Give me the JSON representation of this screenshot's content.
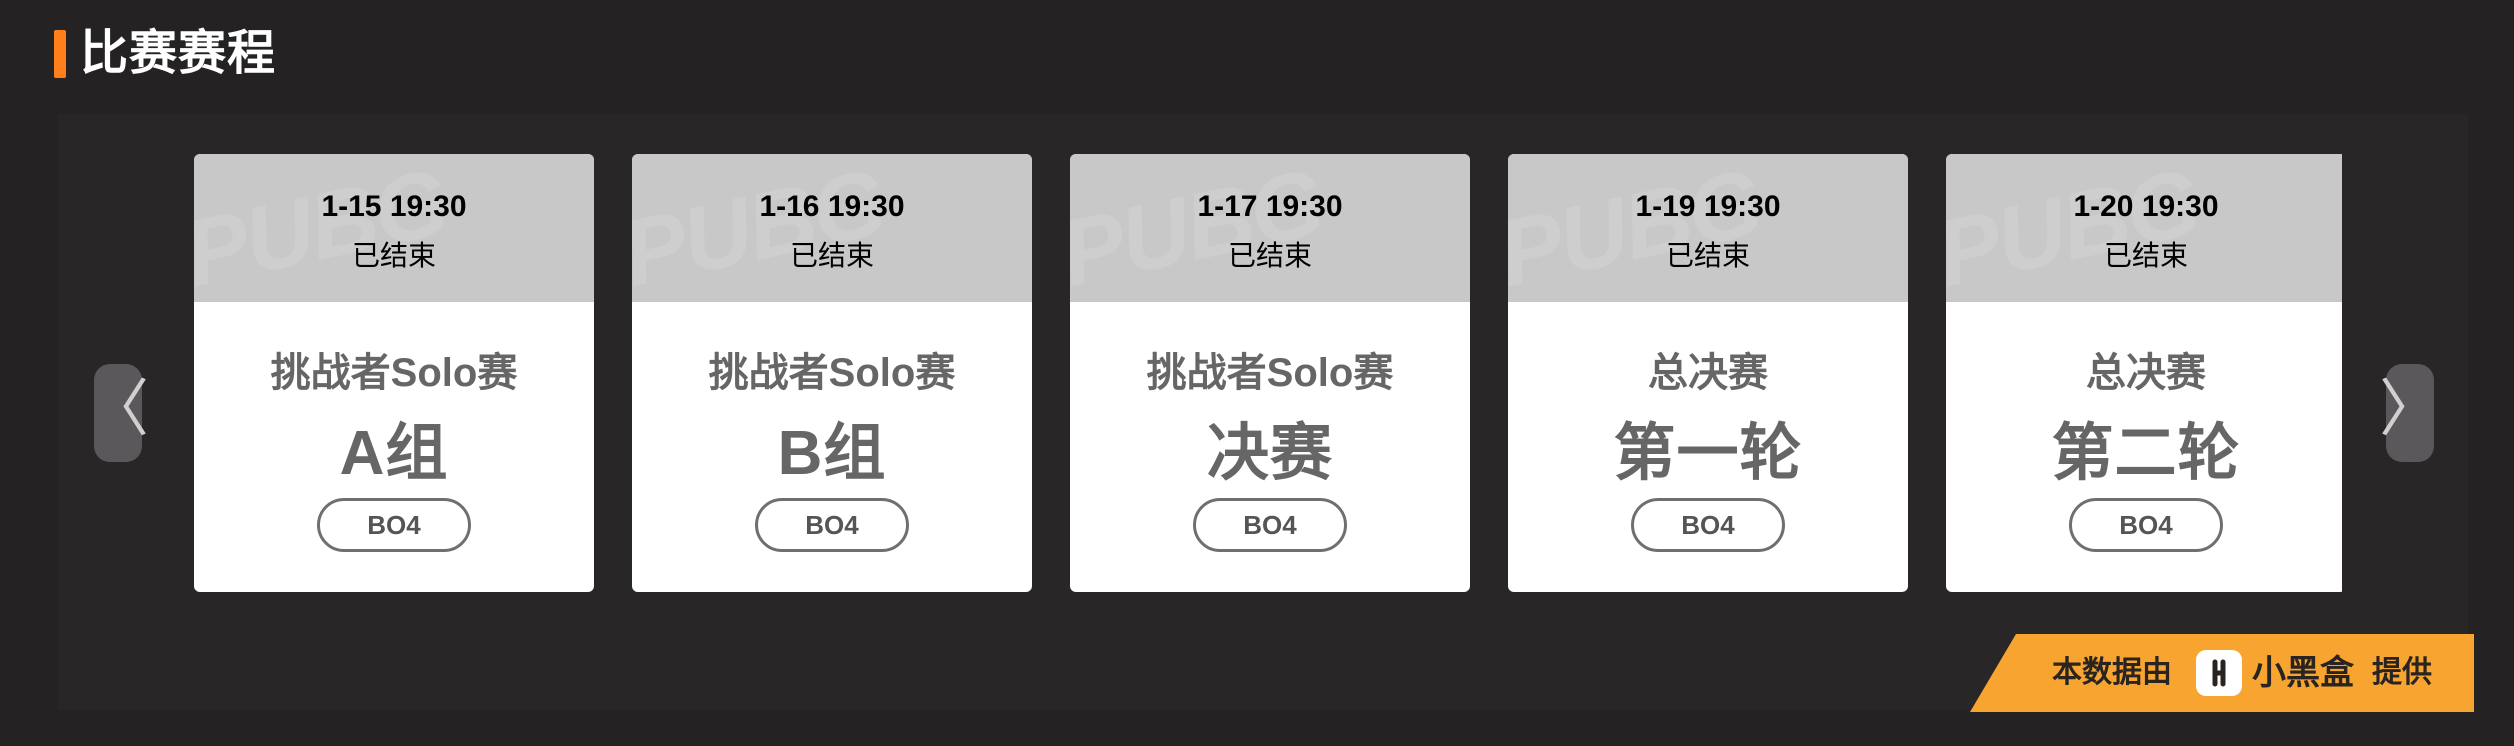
{
  "header": {
    "title": "比赛赛程"
  },
  "carousel": {
    "prev_label": "〈",
    "next_label": "〉"
  },
  "cards": [
    {
      "time": "1-15 19:30",
      "status": "已结束",
      "stage": "挑战者Solo赛",
      "group": "A组",
      "format": "BO4"
    },
    {
      "time": "1-16 19:30",
      "status": "已结束",
      "stage": "挑战者Solo赛",
      "group": "B组",
      "format": "BO4"
    },
    {
      "time": "1-17 19:30",
      "status": "已结束",
      "stage": "挑战者Solo赛",
      "group": "决赛",
      "format": "BO4"
    },
    {
      "time": "1-19 19:30",
      "status": "已结束",
      "stage": "总决赛",
      "group": "第一轮",
      "format": "BO4"
    },
    {
      "time": "1-20 19:30",
      "status": "已结束",
      "stage": "总决赛",
      "group": "第二轮",
      "format": "BO4"
    }
  ],
  "credit": {
    "prefix": "本数据由",
    "brand": "小黑盒",
    "suffix": "提供"
  },
  "colors": {
    "accent": "#ff7f1d",
    "credit_bg": "#f7a431",
    "card_top": "#c8c8c8",
    "background": "#242223"
  },
  "icons": {
    "brand_logo": "xiaoheihe-logo-icon",
    "prev": "chevron-left-icon",
    "next": "chevron-right-icon"
  }
}
